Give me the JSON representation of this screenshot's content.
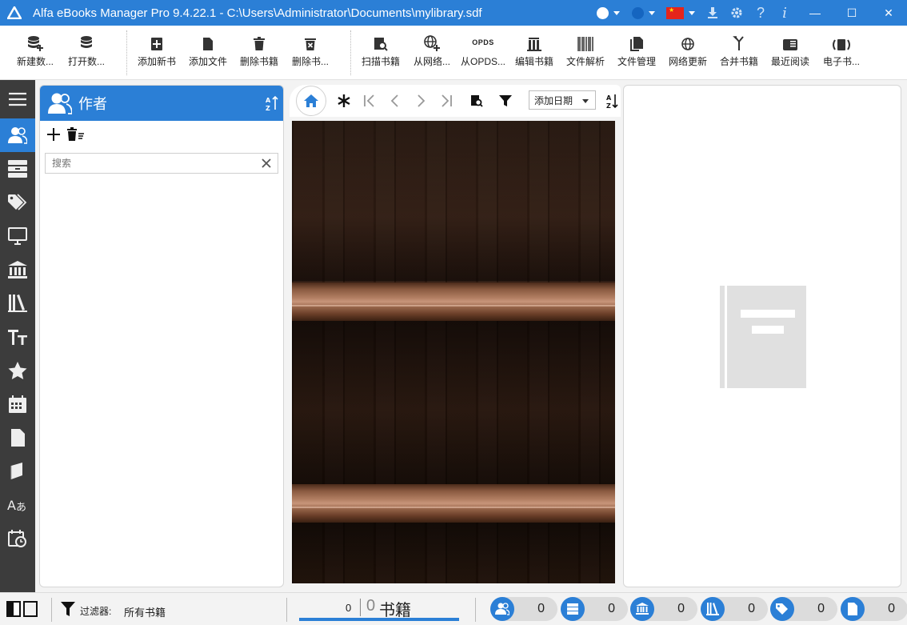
{
  "window": {
    "title": "Alfa eBooks Manager Pro 9.4.22.1 - C:\\Users\\Administrator\\Documents\\mylibrary.sdf",
    "minimize": "—",
    "maximize": "☐",
    "close": "✕"
  },
  "toolbar": {
    "new_db": "新建数...",
    "open_db": "打开数...",
    "add_book": "添加新书",
    "add_file": "添加文件",
    "delete_book": "删除书籍",
    "delete_file": "删除书...",
    "scan_books": "扫描书籍",
    "from_web": "从网络...",
    "from_opds": "从OPDS...",
    "edit_book": "编辑书籍",
    "parse_file": "文件解析",
    "file_manage": "文件管理",
    "web_update": "网络更新",
    "merge_books": "合并书籍",
    "recent_read": "最近阅读",
    "ebook": "电子书...",
    "opds_text": "OPDS"
  },
  "authors_panel": {
    "title": "作者",
    "search_placeholder": "搜索"
  },
  "center": {
    "sort_value": "添加日期"
  },
  "statusbar": {
    "filter_label": "过滤器:",
    "filter_value": "所有书籍",
    "count_selected": "0",
    "count_total": "0",
    "count_label": "书籍",
    "pills": [
      {
        "icon": "authors-icon",
        "value": "0"
      },
      {
        "icon": "shelves-icon",
        "value": "0"
      },
      {
        "icon": "library-icon",
        "value": "0"
      },
      {
        "icon": "books-icon",
        "value": "0"
      },
      {
        "icon": "tags-icon",
        "value": "0"
      },
      {
        "icon": "file-icon",
        "value": "0"
      }
    ]
  },
  "colors": {
    "accent": "#2b7fd6",
    "nav_bg": "#3c3c3c"
  }
}
